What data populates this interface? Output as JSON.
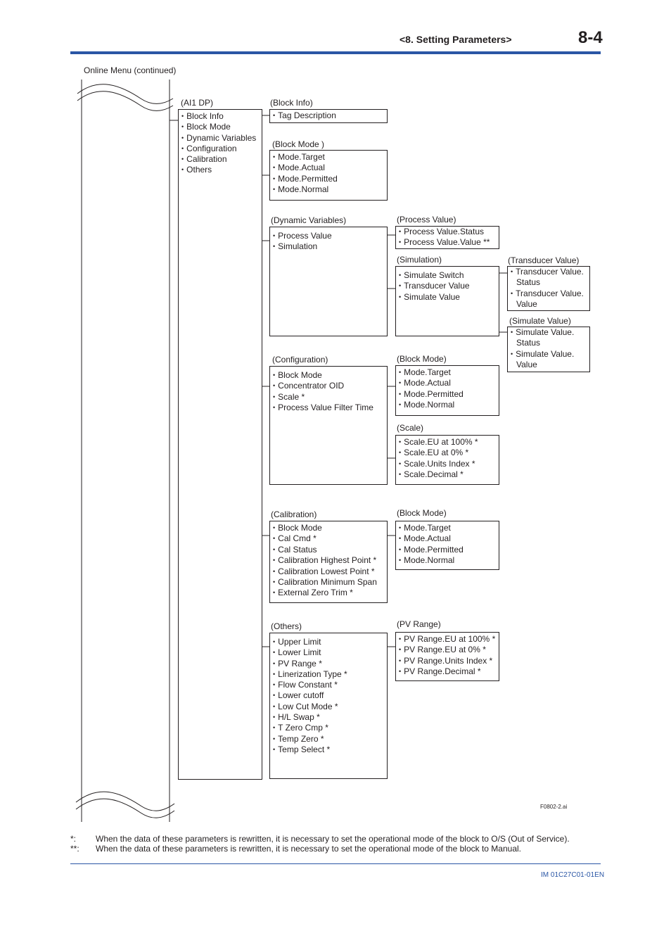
{
  "header": {
    "section": "<8.  Setting Parameters>",
    "page": "8-4"
  },
  "caption": "Online Menu (continued)",
  "figure_id": "F0802-2.ai",
  "tree": {
    "ai1dp": {
      "title": "(AI1 DP)",
      "items": [
        "Block Info",
        "Block Mode",
        "Dynamic Variables",
        "Configuration",
        "Calibration",
        "Others"
      ]
    },
    "block_info": {
      "title": "(Block Info)",
      "items": [
        "Tag Description"
      ]
    },
    "block_mode": {
      "title": "(Block Mode )",
      "items": [
        "Mode.Target",
        "Mode.Actual",
        "Mode.Permitted",
        "Mode.Normal"
      ]
    },
    "dynamic_variables": {
      "title": "(Dynamic Variables)",
      "items": [
        "Process Value",
        "Simulation"
      ]
    },
    "process_value": {
      "title": "(Process Value)",
      "items": [
        "Process Value.Status",
        "Process Value.Value **"
      ]
    },
    "simulation": {
      "title": "(Simulation)",
      "items": [
        "Simulate Switch",
        "Transducer Value",
        "Simulate Value"
      ]
    },
    "transducer_value": {
      "title": "(Transducer Value)",
      "items": [
        "Transducer Value. Status",
        "Transducer Value. Value"
      ]
    },
    "simulate_value": {
      "title": "(Simulate Value)",
      "items": [
        "Simulate Value. Status",
        "Simulate Value. Value"
      ]
    },
    "configuration": {
      "title": "(Configuration)",
      "items": [
        "Block Mode",
        "Concentrator OID",
        "Scale *",
        "Process Value Filter Time"
      ]
    },
    "config_block_mode": {
      "title": "(Block Mode)",
      "items": [
        "Mode.Target",
        "Mode.Actual",
        "Mode.Permitted",
        "Mode.Normal"
      ]
    },
    "scale": {
      "title": "(Scale)",
      "items": [
        "Scale.EU at 100% *",
        "Scale.EU at 0% *",
        "Scale.Units Index *",
        "Scale.Decimal *"
      ]
    },
    "calibration": {
      "title": "(Calibration)",
      "items": [
        "Block Mode",
        "Cal Cmd *",
        "Cal Status",
        "Calibration Highest Point *",
        "Calibration Lowest Point *",
        "Calibration Minimum Span",
        "External Zero Trim *"
      ]
    },
    "cal_block_mode": {
      "title": "(Block Mode)",
      "items": [
        "Mode.Target",
        "Mode.Actual",
        "Mode.Permitted",
        "Mode.Normal"
      ]
    },
    "others": {
      "title": "(Others)",
      "items": [
        "Upper Limit",
        "Lower Limit",
        "PV Range *",
        "Linerization Type *",
        "Flow Constant *",
        "Lower cutoff",
        "Low Cut Mode *",
        "H/L Swap *",
        "T Zero Cmp *",
        "Temp Zero *",
        "Temp Select *"
      ]
    },
    "pv_range": {
      "title": "(PV Range)",
      "items": [
        "PV Range.EU at 100% *",
        "PV Range.EU at 0% *",
        "PV Range.Units Index *",
        "PV Range.Decimal *"
      ]
    }
  },
  "notes": [
    {
      "mark": "*:",
      "text": "When the data of these parameters is rewritten, it is necessary to set the operational mode of the block to O/S (Out of Service)."
    },
    {
      "mark": "**:",
      "text": "When the data of these parameters is rewritten, it is necessary to set the operational mode of the block to Manual."
    }
  ],
  "footer": {
    "doc_id": "IM 01C27C01-01EN"
  }
}
